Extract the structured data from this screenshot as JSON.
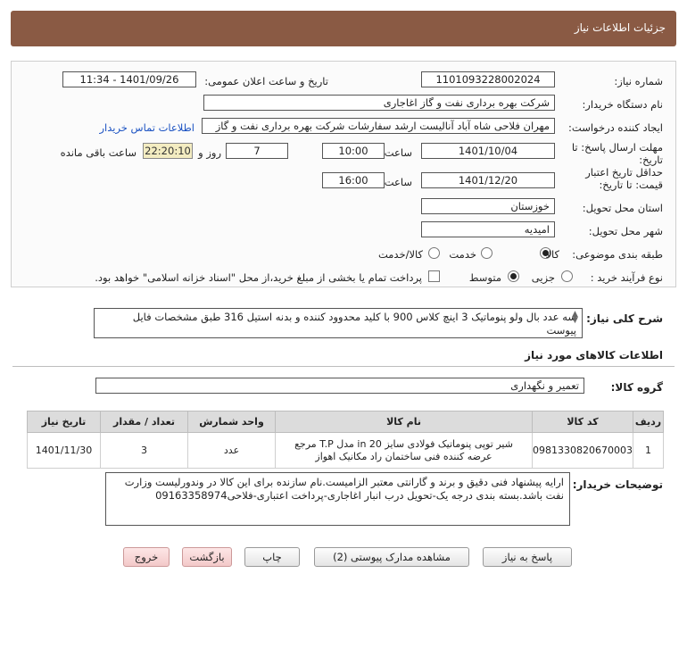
{
  "header": {
    "title": "جزئیات اطلاعات نیاز"
  },
  "form": {
    "need_number_label": "شماره نیاز:",
    "need_number": "1101093228002024",
    "announce_label": "تاریخ و ساعت اعلان عمومی:",
    "announce_value": "1401/09/26 - 11:34",
    "buyer_org_label": "نام دستگاه خریدار:",
    "buyer_org": "شرکت بهره برداری نفت و گاز اغاجاری",
    "requester_label": "ایجاد کننده درخواست:",
    "requester": "مهران فلاحی شاه آباد آنالیست ارشد سفارشات شرکت بهره برداری نفت و گاز",
    "contact_link": "اطلاعات تماس خریدار",
    "reply_deadline_label": "مهلت ارسال پاسخ: تا تاریخ:",
    "reply_date": "1401/10/04",
    "time_label": "ساعت",
    "reply_time": "10:00",
    "days_value": "7",
    "days_label": "روز و",
    "remaining_time": "22:20:10",
    "remaining_label": "ساعت باقی مانده",
    "validity_label": "حداقل تاریخ اعتبار قیمت: تا تاریخ:",
    "validity_date": "1401/12/20",
    "validity_time": "16:00",
    "province_label": "استان محل تحویل:",
    "province": "خوزستان",
    "city_label": "شهر محل تحویل:",
    "city": "امیدیه",
    "category_label": "طبقه بندی موضوعی:",
    "category_options": [
      "کالا",
      "خدمت",
      "کالا/خدمت"
    ],
    "purchase_type_label": "نوع فرآیند خرید :",
    "purchase_options": [
      "جزیی",
      "متوسط"
    ],
    "treasury_note": "پرداخت تمام یا بخشی از مبلغ خرید،از محل \"اسناد خزانه اسلامی\" خواهد بود."
  },
  "summary": {
    "label": "شرح کلی نیاز:",
    "text": "سه عدد بال ولو پنوماتیک 3 اینچ کلاس 900 با کلید محدوود کننده و بدنه استیل 316 طبق مشخصات فایل پیوست"
  },
  "goods": {
    "section_title": "اطلاعات کالاهای مورد نیاز",
    "group_label": "گروه کالا:",
    "group_value": "تعمیر و نگهداری",
    "columns": [
      "ردیف",
      "کد کالا",
      "نام کالا",
      "واحد شمارش",
      "تعداد / مقدار",
      "تاریخ نیاز"
    ],
    "rows": [
      {
        "row": "1",
        "code": "0981330820670003",
        "name": "شیر توپی پنوماتیک فولادی سایز 20 in مدل T.P مرجع عرضه کننده فنی ساختمان راد مکانیک اهواز",
        "unit": "عدد",
        "qty": "3",
        "date": "1401/11/30"
      }
    ]
  },
  "buyer_notes": {
    "label": "توضیحات خریدار:",
    "text": "ارایه پیشنهاد فنی دقیق و برند و گارانتی معتبر الزامیست.نام سازنده برای این کالا در وندورلیست وزارت نفت باشد.بسته بندی درجه یک-تحویل درب انبار اغاجاری-پرداخت اعتباری-فلاحی09163358974"
  },
  "buttons": {
    "reply": "پاسخ به نیاز",
    "attachments": "مشاهده مدارک پیوستی (2)",
    "print": "چاپ",
    "back": "بازگشت",
    "exit": "خروج"
  }
}
